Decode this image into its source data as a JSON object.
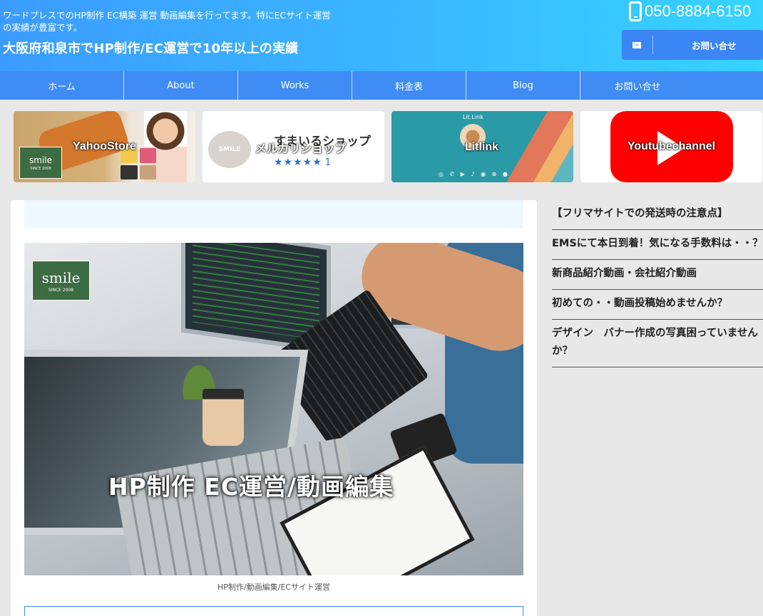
{
  "header": {
    "tagline": "ワードプレスでのHP制作 EC構築 運営 動画編集を行ってます。特にECサイト運営の実績が豊富です。",
    "site_title": "大阪府和泉市でHP制作/EC運営で10年以上の実績",
    "phone_icon": "phone-icon",
    "phone_number": "050-8884-6150",
    "contact_icon": "mail-icon",
    "contact_label": "お問い合せ",
    "gradient_colors": [
      "#3b9cff",
      "#35d3ff"
    ]
  },
  "nav": {
    "items": [
      {
        "label": "ホーム"
      },
      {
        "label": "About"
      },
      {
        "label": "Works"
      },
      {
        "label": "料金表"
      },
      {
        "label": "Blog"
      },
      {
        "label": "お問い合せ"
      }
    ],
    "color": "#3f8cf5"
  },
  "banners": [
    {
      "label": "YahooStore",
      "logo_text": "smile",
      "logo_sub": "SINCE 2008"
    },
    {
      "label": "メルカリショップ",
      "shop_title": "すまいるショップ",
      "rating_stars": "★★★★★",
      "rating_count": "1",
      "circle_text": "SMILE"
    },
    {
      "label": "Litlink",
      "brand": "Lit.Link",
      "social_icons": "◎ ✆ ▶ ♪ ◉ ⊕ ●"
    },
    {
      "label": "Youtubechannel",
      "icon": "youtube-play-icon",
      "color": "#ff0000"
    }
  ],
  "hero": {
    "logo_text": "smile",
    "logo_sub": "SINCE 2008",
    "overlay_text": "HP制作 EC運営/動画編集",
    "caption": "HP制作/動画編集/ECサイト運営"
  },
  "sidebar": {
    "items": [
      {
        "label": "【フリマサイトでの発送時の注意点】"
      },
      {
        "label": "EMSにて本日到着！気になる手数料は・・？"
      },
      {
        "label": "新商品紹介動画・会社紹介動画"
      },
      {
        "label": "初めての・・動画投稿始めませんか？"
      },
      {
        "label": "デザイン　バナー作成の写真困っていませんか？"
      }
    ]
  }
}
